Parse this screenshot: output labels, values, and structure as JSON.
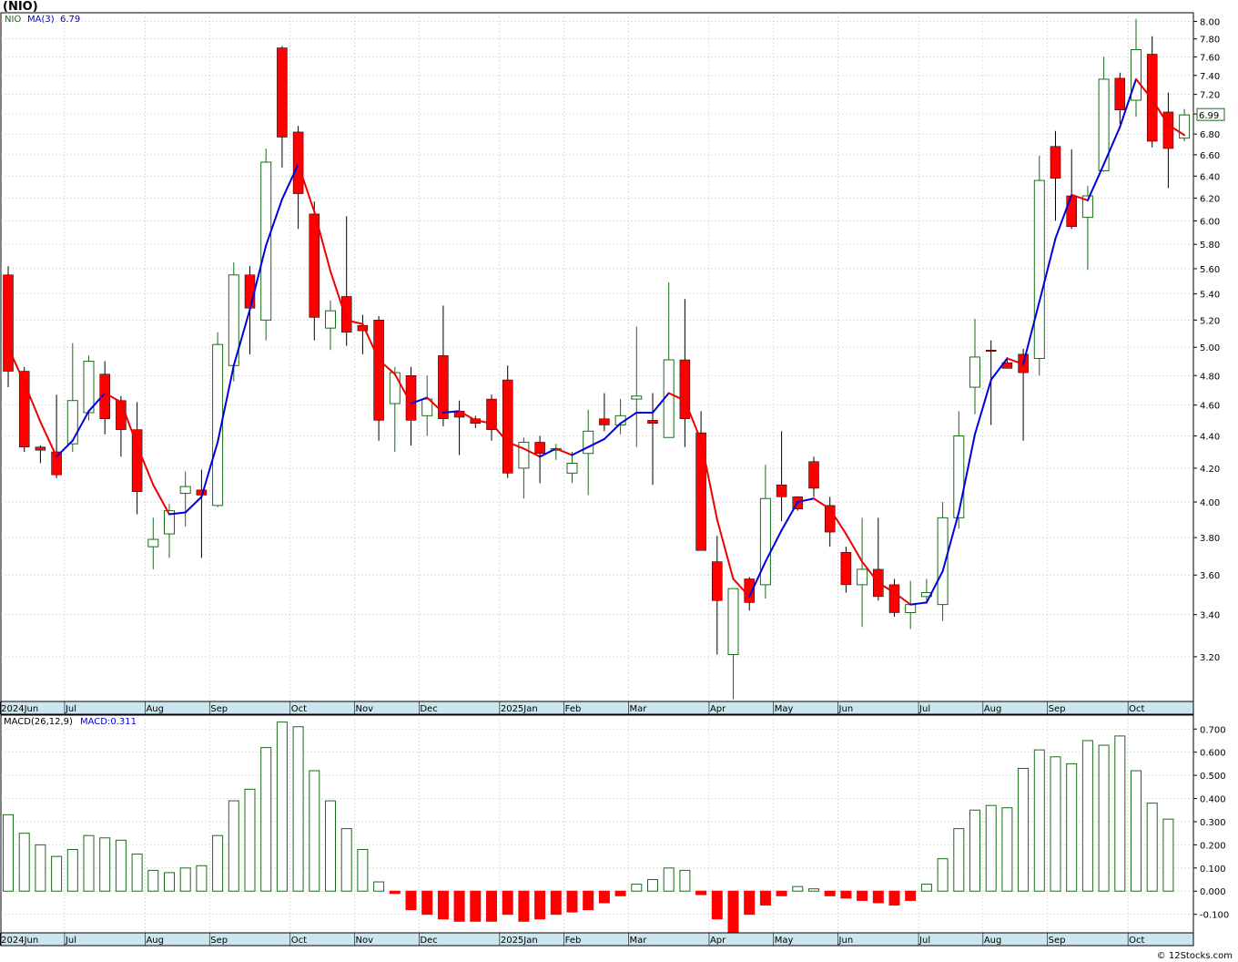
{
  "title": "(NIO)",
  "credit": "© 12Stocks.com",
  "price_legend": {
    "symbol": "NIO",
    "ma_label": "MA(3)",
    "ma_value": "6.79"
  },
  "macd_legend": {
    "label": "MACD(26,12,9)",
    "value_label": "MACD:0.311"
  },
  "last_price_label": "6.99",
  "colors": {
    "up_candle": "#1a6b1a",
    "down_candle": "#ff0000",
    "ma_up": "#0000dd",
    "ma_down": "#ee0000",
    "macd_positive": "#1a6b1a",
    "macd_negative": "#ff0000",
    "axis_band": "#cce6f0",
    "grid": "#c8c8c8"
  },
  "chart_data": [
    {
      "type": "candlestick",
      "interval": "weekly",
      "series_name": "NIO",
      "y_scale": "log",
      "ylim": [
        3.0,
        8.1
      ],
      "y_ticks": [
        3.2,
        3.4,
        3.6,
        3.8,
        4.0,
        4.2,
        4.4,
        4.6,
        4.8,
        5.0,
        5.2,
        5.4,
        5.6,
        5.8,
        6.0,
        6.2,
        6.4,
        6.6,
        6.8,
        7.0,
        7.2,
        7.4,
        7.6,
        7.8,
        8.0
      ],
      "y_tick_labels": [
        "3.20",
        "3.40",
        "3.60",
        "3.80",
        "4.00",
        "4.20",
        "4.40",
        "4.60",
        "4.80",
        "5.00",
        "5.20",
        "5.40",
        "5.60",
        "5.80",
        "6.00",
        "6.20",
        "6.40",
        "6.60",
        "6.80",
        "7.00",
        "7.20",
        "7.40",
        "7.60",
        "7.80",
        "8.00"
      ],
      "x_labels": [
        {
          "label": "2024Jun",
          "week": 0
        },
        {
          "label": "Jul",
          "week": 4
        },
        {
          "label": "Aug",
          "week": 9
        },
        {
          "label": "Sep",
          "week": 13
        },
        {
          "label": "Oct",
          "week": 18
        },
        {
          "label": "Nov",
          "week": 22
        },
        {
          "label": "Dec",
          "week": 26
        },
        {
          "label": "2025Jan",
          "week": 31
        },
        {
          "label": "Feb",
          "week": 35
        },
        {
          "label": "Mar",
          "week": 39
        },
        {
          "label": "Apr",
          "week": 44
        },
        {
          "label": "May",
          "week": 48
        },
        {
          "label": "Jun",
          "week": 52
        },
        {
          "label": "Jul",
          "week": 57
        },
        {
          "label": "Aug",
          "week": 61
        },
        {
          "label": "Sep",
          "week": 65
        },
        {
          "label": "Oct",
          "week": 70
        }
      ],
      "candles": [
        [
          5.55,
          5.62,
          4.72,
          4.83
        ],
        [
          4.83,
          4.86,
          4.3,
          4.33
        ],
        [
          4.33,
          4.34,
          4.23,
          4.31
        ],
        [
          4.3,
          4.67,
          4.14,
          4.16
        ],
        [
          4.35,
          5.03,
          4.3,
          4.63
        ],
        [
          4.55,
          4.94,
          4.5,
          4.9
        ],
        [
          4.81,
          4.9,
          4.41,
          4.51
        ],
        [
          4.63,
          4.66,
          4.27,
          4.44
        ],
        [
          4.44,
          4.62,
          3.93,
          4.06
        ],
        [
          3.75,
          3.91,
          3.63,
          3.79
        ],
        [
          3.82,
          3.99,
          3.69,
          3.95
        ],
        [
          4.05,
          4.18,
          3.86,
          4.09
        ],
        [
          4.07,
          4.19,
          3.69,
          4.04
        ],
        [
          3.98,
          5.11,
          3.97,
          5.02
        ],
        [
          4.87,
          5.65,
          4.76,
          5.55
        ],
        [
          5.55,
          5.62,
          4.95,
          5.29
        ],
        [
          5.2,
          6.66,
          5.05,
          6.53
        ],
        [
          7.7,
          7.72,
          6.48,
          6.77
        ],
        [
          6.82,
          6.88,
          5.93,
          6.24
        ],
        [
          6.06,
          6.17,
          5.05,
          5.22
        ],
        [
          5.14,
          5.35,
          4.98,
          5.27
        ],
        [
          5.38,
          6.04,
          5.01,
          5.11
        ],
        [
          5.16,
          5.24,
          4.95,
          5.12
        ],
        [
          5.2,
          5.23,
          4.37,
          4.5
        ],
        [
          4.61,
          4.86,
          4.3,
          4.82
        ],
        [
          4.8,
          4.86,
          4.34,
          4.5
        ],
        [
          4.53,
          4.8,
          4.4,
          4.64
        ],
        [
          4.94,
          5.31,
          4.46,
          4.51
        ],
        [
          4.56,
          4.63,
          4.28,
          4.52
        ],
        [
          4.51,
          4.53,
          4.45,
          4.48
        ],
        [
          4.64,
          4.67,
          4.37,
          4.44
        ],
        [
          4.77,
          4.87,
          4.14,
          4.17
        ],
        [
          4.2,
          4.39,
          4.02,
          4.36
        ],
        [
          4.36,
          4.4,
          4.11,
          4.29
        ],
        [
          4.31,
          4.35,
          4.25,
          4.32
        ],
        [
          4.17,
          4.3,
          4.11,
          4.23
        ],
        [
          4.29,
          4.57,
          4.04,
          4.43
        ],
        [
          4.51,
          4.68,
          4.43,
          4.47
        ],
        [
          4.47,
          4.64,
          4.41,
          4.53
        ],
        [
          4.64,
          5.15,
          4.33,
          4.66
        ],
        [
          4.5,
          4.68,
          4.1,
          4.48
        ],
        [
          4.39,
          5.49,
          4.39,
          4.91
        ],
        [
          4.91,
          5.36,
          4.33,
          4.51
        ],
        [
          4.42,
          4.56,
          3.76,
          3.73
        ],
        [
          3.67,
          3.81,
          3.21,
          3.47
        ],
        [
          3.21,
          3.52,
          3.01,
          3.53
        ],
        [
          3.58,
          3.59,
          3.42,
          3.46
        ],
        [
          3.55,
          4.22,
          3.48,
          4.02
        ],
        [
          4.1,
          4.43,
          3.89,
          4.03
        ],
        [
          4.03,
          4.03,
          3.95,
          3.96
        ],
        [
          4.24,
          4.27,
          4.03,
          4.08
        ],
        [
          3.98,
          4.03,
          3.75,
          3.83
        ],
        [
          3.72,
          3.75,
          3.51,
          3.55
        ],
        [
          3.55,
          3.91,
          3.34,
          3.63
        ],
        [
          3.63,
          3.91,
          3.47,
          3.49
        ],
        [
          3.55,
          3.58,
          3.39,
          3.41
        ],
        [
          3.41,
          3.57,
          3.33,
          3.45
        ],
        [
          3.49,
          3.58,
          3.46,
          3.51
        ],
        [
          3.45,
          4.0,
          3.37,
          3.91
        ],
        [
          3.91,
          4.56,
          3.85,
          4.4
        ],
        [
          4.72,
          5.21,
          4.54,
          4.93
        ],
        [
          4.98,
          5.05,
          4.47,
          4.97
        ],
        [
          4.89,
          4.93,
          4.86,
          4.85
        ],
        [
          4.95,
          4.99,
          4.37,
          4.82
        ],
        [
          4.92,
          6.59,
          4.8,
          6.36
        ],
        [
          6.68,
          6.83,
          6.0,
          6.38
        ],
        [
          6.22,
          6.65,
          5.93,
          5.95
        ],
        [
          6.03,
          6.31,
          5.59,
          6.22
        ],
        [
          6.45,
          7.6,
          6.44,
          7.36
        ],
        [
          7.37,
          7.43,
          6.9,
          7.04
        ],
        [
          7.14,
          8.03,
          6.97,
          7.68
        ],
        [
          7.63,
          7.83,
          6.67,
          6.73
        ],
        [
          7.02,
          7.22,
          6.29,
          6.66
        ],
        [
          6.76,
          7.05,
          6.73,
          6.99
        ]
      ],
      "ma3": [
        5.0,
        4.75,
        4.49,
        4.27,
        4.37,
        4.56,
        4.68,
        4.62,
        4.34,
        4.1,
        3.93,
        3.94,
        4.03,
        4.36,
        4.87,
        5.28,
        5.79,
        6.19,
        6.51,
        6.08,
        5.58,
        5.2,
        5.17,
        4.91,
        4.81,
        4.61,
        4.65,
        4.55,
        4.56,
        4.5,
        4.48,
        4.36,
        4.32,
        4.27,
        4.32,
        4.28,
        4.33,
        4.38,
        4.48,
        4.55,
        4.55,
        4.68,
        4.63,
        4.37,
        3.9,
        3.58,
        3.49,
        3.67,
        3.84,
        4.0,
        4.02,
        3.96,
        3.82,
        3.67,
        3.56,
        3.51,
        3.45,
        3.46,
        3.62,
        3.94,
        4.41,
        4.77,
        4.92,
        4.88,
        5.34,
        5.85,
        6.23,
        6.18,
        6.51,
        6.87,
        7.36,
        7.15,
        6.89,
        6.79
      ]
    },
    {
      "type": "bar",
      "series_name": "MACD(26,12,9)",
      "ylim": [
        -0.18,
        0.76
      ],
      "y_ticks": [
        -0.1,
        0.0,
        0.1,
        0.2,
        0.3,
        0.4,
        0.5,
        0.6,
        0.7
      ],
      "y_tick_labels": [
        "-0.100",
        "0.000",
        "0.100",
        "0.200",
        "0.300",
        "0.400",
        "0.500",
        "0.600",
        "0.700"
      ],
      "values": [
        0.33,
        0.25,
        0.2,
        0.15,
        0.18,
        0.24,
        0.23,
        0.22,
        0.16,
        0.09,
        0.08,
        0.1,
        0.11,
        0.24,
        0.39,
        0.44,
        0.62,
        0.73,
        0.71,
        0.52,
        0.39,
        0.27,
        0.18,
        0.04,
        -0.01,
        -0.08,
        -0.1,
        -0.12,
        -0.13,
        -0.13,
        -0.13,
        -0.1,
        -0.13,
        -0.12,
        -0.1,
        -0.09,
        -0.08,
        -0.05,
        -0.02,
        0.03,
        0.05,
        0.1,
        0.09,
        -0.015,
        -0.12,
        -0.18,
        -0.1,
        -0.06,
        -0.02,
        0.02,
        0.01,
        -0.02,
        -0.03,
        -0.04,
        -0.05,
        -0.06,
        -0.04,
        0.03,
        0.14,
        0.27,
        0.35,
        0.37,
        0.36,
        0.53,
        0.61,
        0.58,
        0.55,
        0.65,
        0.63,
        0.67,
        0.52,
        0.38,
        0.311
      ]
    }
  ]
}
